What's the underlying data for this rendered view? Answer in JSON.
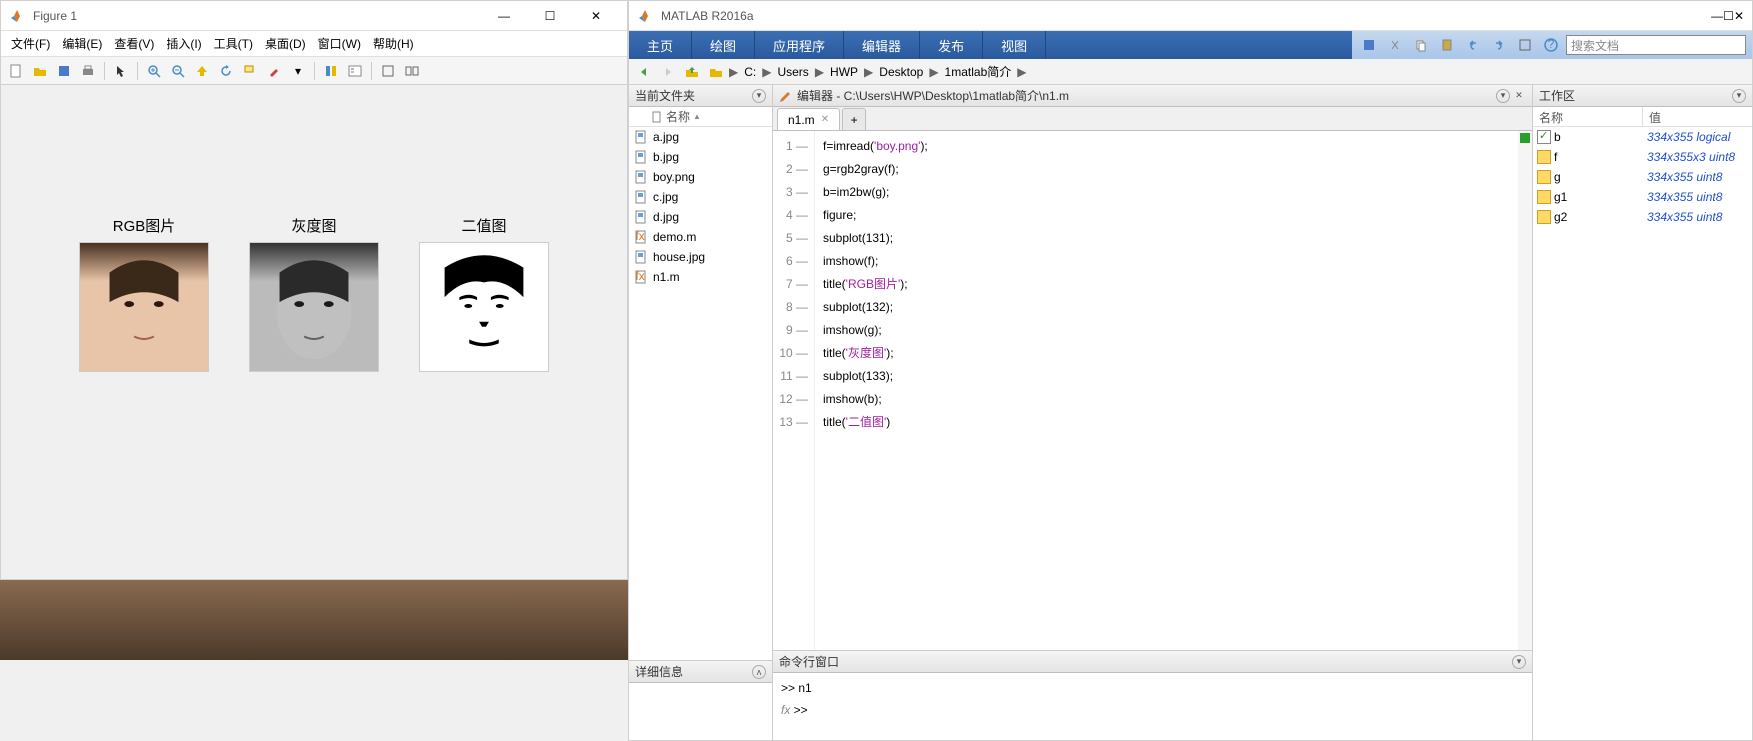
{
  "figure": {
    "title": "Figure 1",
    "menus": [
      "文件(F)",
      "编辑(E)",
      "查看(V)",
      "插入(I)",
      "工具(T)",
      "桌面(D)",
      "窗口(W)",
      "帮助(H)"
    ],
    "subplots": [
      {
        "title": "RGB图片"
      },
      {
        "title": "灰度图"
      },
      {
        "title": "二值图"
      }
    ]
  },
  "matlab": {
    "title": "MATLAB R2016a",
    "tabs": [
      "主页",
      "绘图",
      "应用程序",
      "编辑器",
      "发布",
      "视图"
    ],
    "search_placeholder": "搜索文档",
    "path": [
      "C:",
      "Users",
      "HWP",
      "Desktop",
      "1matlab简介"
    ],
    "filePanel": {
      "title": "当前文件夹",
      "nameHdr": "名称",
      "files": [
        {
          "name": "a.jpg",
          "type": "img"
        },
        {
          "name": "b.jpg",
          "type": "img"
        },
        {
          "name": "boy.png",
          "type": "img"
        },
        {
          "name": "c.jpg",
          "type": "img"
        },
        {
          "name": "d.jpg",
          "type": "img"
        },
        {
          "name": "demo.m",
          "type": "m"
        },
        {
          "name": "house.jpg",
          "type": "img"
        },
        {
          "name": "n1.m",
          "type": "m"
        }
      ],
      "detailsTitle": "详细信息"
    },
    "editor": {
      "title": "编辑器 - C:\\Users\\HWP\\Desktop\\1matlab简介\\n1.m",
      "tab": "n1.m",
      "code": [
        {
          "n": 1,
          "pre": "f=imread(",
          "str": "'boy.png'",
          "post": ");"
        },
        {
          "n": 2,
          "pre": "g=rgb2gray(f);",
          "str": "",
          "post": ""
        },
        {
          "n": 3,
          "pre": "b=im2bw(g);",
          "str": "",
          "post": ""
        },
        {
          "n": 4,
          "pre": "figure;",
          "str": "",
          "post": ""
        },
        {
          "n": 5,
          "pre": "subplot(131);",
          "str": "",
          "post": ""
        },
        {
          "n": 6,
          "pre": "imshow(f);",
          "str": "",
          "post": ""
        },
        {
          "n": 7,
          "pre": "title(",
          "str": "'RGB图片'",
          "post": ");"
        },
        {
          "n": 8,
          "pre": "subplot(132);",
          "str": "",
          "post": ""
        },
        {
          "n": 9,
          "pre": "imshow(g);",
          "str": "",
          "post": ""
        },
        {
          "n": 10,
          "pre": "title(",
          "str": "'灰度图'",
          "post": ");"
        },
        {
          "n": 11,
          "pre": "subplot(133);",
          "str": "",
          "post": ""
        },
        {
          "n": 12,
          "pre": "imshow(b);",
          "str": "",
          "post": ""
        },
        {
          "n": 13,
          "pre": "title(",
          "str": "'二值图'",
          "post": ")"
        }
      ]
    },
    "cmd": {
      "title": "命令行窗口",
      "lines": [
        ">> n1",
        ">> "
      ]
    },
    "workspace": {
      "title": "工作区",
      "nameHdr": "名称",
      "valHdr": "值",
      "vars": [
        {
          "name": "b",
          "value": "334x355 logical",
          "type": "logical"
        },
        {
          "name": "f",
          "value": "334x355x3 uint8",
          "type": "num"
        },
        {
          "name": "g",
          "value": "334x355 uint8",
          "type": "num"
        },
        {
          "name": "g1",
          "value": "334x355 uint8",
          "type": "num"
        },
        {
          "name": "g2",
          "value": "334x355 uint8",
          "type": "num"
        }
      ]
    }
  }
}
